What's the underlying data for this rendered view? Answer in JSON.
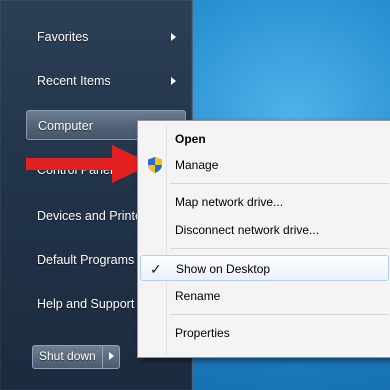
{
  "start_menu": {
    "items": [
      {
        "label": "Favorites",
        "has_submenu": true
      },
      {
        "label": "Recent Items",
        "has_submenu": true
      },
      {
        "label": "Computer",
        "has_submenu": false
      },
      {
        "label": "Control Panel",
        "has_submenu": false
      },
      {
        "label": "Devices and Printers",
        "has_submenu": false
      },
      {
        "label": "Default Programs",
        "has_submenu": false
      },
      {
        "label": "Help and Support",
        "has_submenu": false
      }
    ],
    "shutdown_label": "Shut down"
  },
  "context_menu": {
    "items": [
      {
        "label": "Open",
        "bold": true
      },
      {
        "label": "Manage",
        "icon": "uac-shield-icon"
      },
      {
        "label": "Map network drive..."
      },
      {
        "label": "Disconnect network drive..."
      },
      {
        "label": "Show on Desktop",
        "checked": true
      },
      {
        "label": "Rename"
      },
      {
        "label": "Properties"
      }
    ],
    "check_glyph": "✓"
  },
  "annotation": {
    "arrow_color": "#e1201f",
    "points_to": "Manage"
  },
  "colors": {
    "start_menu_bg": "#22344a",
    "desktop_accent": "#1f86c9",
    "context_bg": "#f4f4f4"
  }
}
